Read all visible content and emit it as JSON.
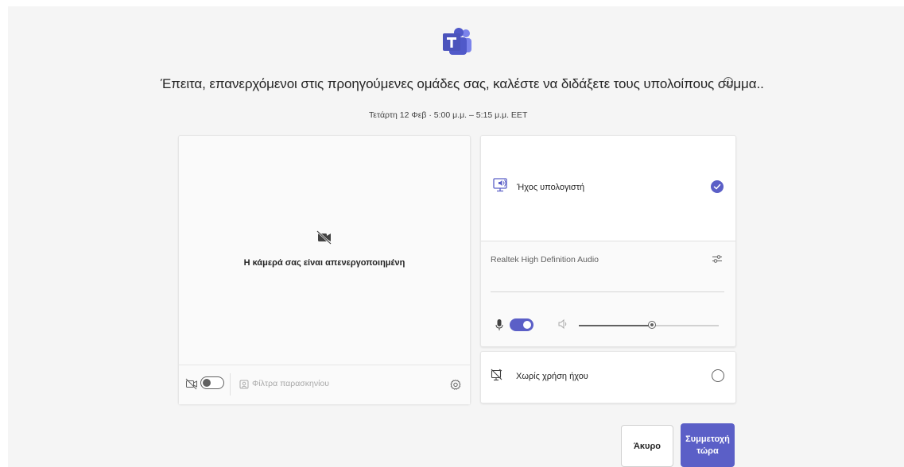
{
  "app": {
    "logo_icon": "microsoft-teams-logo",
    "accent_color": "#5b5fc7"
  },
  "meeting": {
    "title": "Έπειτα, επανερχόμενοι στις προηγούμενες ομάδες σας, καλέστε να διδάξετε τους υπολοίπους συμμα...",
    "time": "Τετάρτη 12 Φεβ  ·  5:00 μ.μ.  –  5:15 μ.μ. EET"
  },
  "video": {
    "camera_off_text": "Η κάμερά σας είναι απενεργοποιημένη",
    "camera_toggle_on": false,
    "background_filters_label": "Φίλτρα παρασκηνίου"
  },
  "audio": {
    "computer_audio_label": "Ήχος υπολογιστή",
    "computer_audio_selected": true,
    "device_name": "Realtek High Definition Audio",
    "mic_on": true,
    "speaker_volume_fraction": 0.52,
    "no_audio_label": "Χωρίς χρήση ήχου",
    "no_audio_selected": false
  },
  "actions": {
    "cancel_label": "Άκυρο",
    "join_label": "Συμμετοχή τώρα"
  }
}
